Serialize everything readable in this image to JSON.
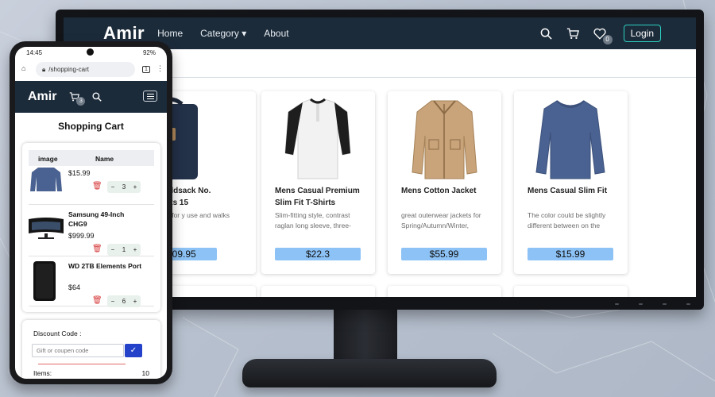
{
  "desktop": {
    "logo": "Amir",
    "nav": [
      "Home",
      "Category",
      "About"
    ],
    "wishlist_count": "0",
    "login_label": "Login",
    "products": [
      {
        "title": "Fjallraven - Foldsack No. 1 Backpack, Fits 15",
        "visible_title": "ven - Foldsack No.\nback, Fits 15",
        "desc": "rfect pack for\ny use and walks in",
        "price": "$109.95"
      },
      {
        "title": "Mens Casual Premium Slim Fit T-Shirts",
        "desc": "Slim-fitting style, contrast raglan long sleeve, three-",
        "price": "$22.3"
      },
      {
        "title": "Mens Cotton Jacket",
        "desc": "great outerwear jackets for Spring/Autumn/Winter,",
        "price": "$55.99"
      },
      {
        "title": "Mens Casual Slim Fit",
        "desc": "The color could be slightly different between on the",
        "price": "$15.99"
      }
    ]
  },
  "phone": {
    "status_time": "14:45",
    "status_battery": "92%",
    "url": "/shopping-cart",
    "tab_count": "1",
    "logo": "Amir",
    "cart_count": "3",
    "heading": "Shopping Cart",
    "cart_headers": [
      "image",
      "Name"
    ],
    "cart_items": [
      {
        "name": "",
        "price": "$15.99",
        "qty": "3"
      },
      {
        "name": "Samsung 49-Inch CHG9",
        "price": "$999.99",
        "qty": "1"
      },
      {
        "name": "WD 2TB Elements Port",
        "price": "$64",
        "qty": "6"
      }
    ],
    "discount_label": "Discount Code :",
    "discount_placeholder": "Gift or coupen code",
    "items_label": "Items:",
    "items_value": "10"
  },
  "colors": {
    "navbar": "#1c2b3a",
    "price_tag": "#8cc2f5",
    "login_border": "#2bd0c0",
    "apply_button": "#2442c9",
    "trash": "#d63a3a"
  }
}
